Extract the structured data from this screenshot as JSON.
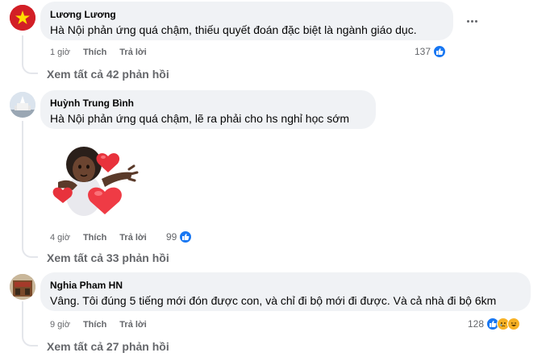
{
  "comments": [
    {
      "author": "Lương Lương",
      "text": "Hà Nội phản ứng quá chậm, thiếu quyết đoán đặc biệt là ngành giáo dục.",
      "time": "1 giờ",
      "like_label": "Thích",
      "reply_label": "Trả lời",
      "reaction_count": "137",
      "reactions": [
        "like-icon"
      ],
      "view_replies": "Xem tất cả 42 phản hồi"
    },
    {
      "author": "Huỳnh Trung Bình",
      "text": "Hà Nội phản ứng quá chậm, lẽ ra phải cho hs nghỉ học sớm",
      "sticker": "avatar-hug-with-hearts-sticker",
      "time": "4 giờ",
      "like_label": "Thích",
      "reply_label": "Trả lời",
      "reaction_count": "99",
      "reactions": [
        "like-icon"
      ],
      "view_replies": "Xem tất cả 33 phản hồi"
    },
    {
      "author": "Nghia Pham HN",
      "text": "Vâng. Tôi đúng 5 tiếng mới đón được con, và chỉ đi bộ mới đi được. Và cả nhà đi bộ 6km",
      "time": "9 giờ",
      "like_label": "Thích",
      "reply_label": "Trả lời",
      "reaction_count": "128",
      "reactions": [
        "like-icon",
        "sad-icon",
        "haha-icon"
      ],
      "view_replies": "Xem tất cả 27 phản hồi"
    }
  ],
  "colors": {
    "bubble": "#f0f2f5",
    "secondary_text": "#65676b",
    "like_blue": "#1877f2",
    "heart_red": "#e8323c"
  }
}
